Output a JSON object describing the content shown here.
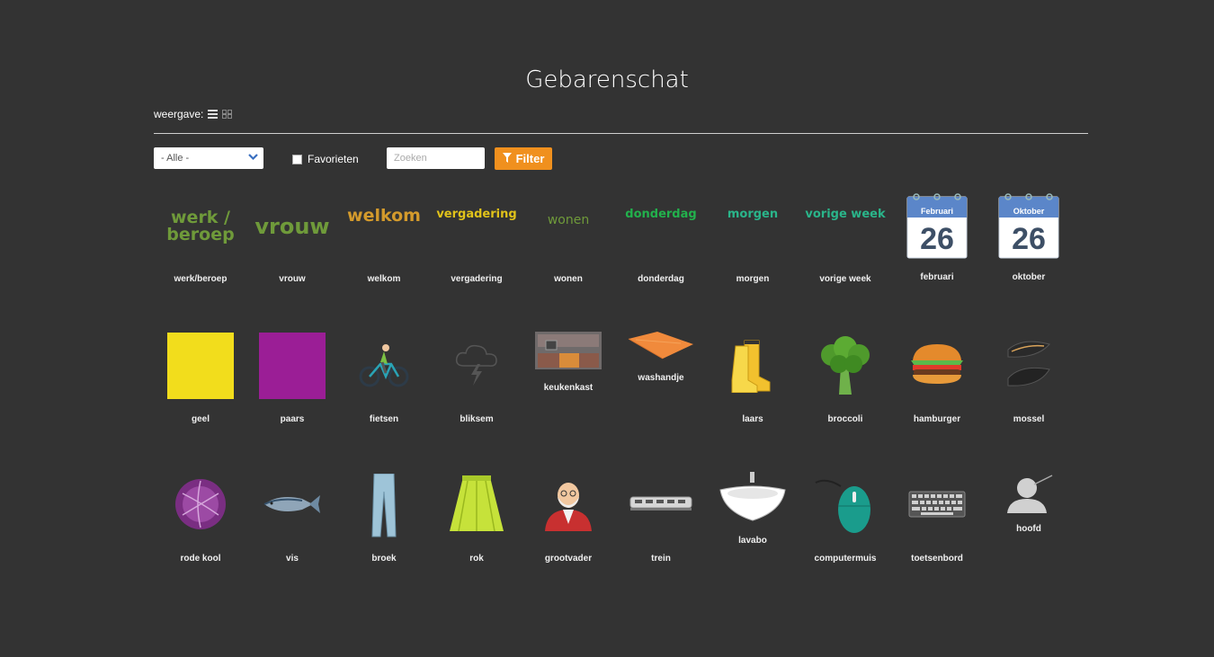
{
  "page": {
    "title": "Gebarenschat"
  },
  "view": {
    "label": "weergave:"
  },
  "filters": {
    "category_selected": "- Alle -",
    "favorites_label": "Favorieten",
    "search_placeholder": "Zoeken",
    "filter_label": "Filter"
  },
  "colors": {
    "background": "#333333",
    "accent": "#f0901e",
    "calendar_blue": "#5b86c9"
  },
  "items": [
    {
      "label": "werk/beroep",
      "image_text": "werk /\nberoep",
      "image_color": "#6f9a3a"
    },
    {
      "label": "vrouw",
      "image_text": "vrouw",
      "image_color": "#6f9a3a"
    },
    {
      "label": "welkom",
      "image_text": "welkom",
      "image_color": "#d39a2c"
    },
    {
      "label": "vergadering",
      "image_text": "vergadering",
      "image_color": "#e0c21a"
    },
    {
      "label": "wonen",
      "image_text": "wonen",
      "image_color": "#6f9a3a"
    },
    {
      "label": "donderdag",
      "image_text": "donderdag",
      "image_color": "#22b14c"
    },
    {
      "label": "morgen",
      "image_text": "morgen",
      "image_color": "#2ab58a"
    },
    {
      "label": "vorige week",
      "image_text": "vorige week",
      "image_color": "#2ab58a"
    },
    {
      "label": "februari",
      "calendar_month": "Februari",
      "calendar_day": "26"
    },
    {
      "label": "oktober",
      "calendar_month": "Oktober",
      "calendar_day": "26"
    },
    {
      "label": "geel",
      "image_color": "#f2dd1c"
    },
    {
      "label": "paars",
      "image_color": "#9b1e96"
    },
    {
      "label": "fietsen",
      "icon": "cyclist-icon"
    },
    {
      "label": "bliksem",
      "icon": "thundercloud-icon"
    },
    {
      "label": "keukenkast",
      "icon": "kitchen-cabinet-icon"
    },
    {
      "label": "washandje",
      "icon": "washcloth-icon"
    },
    {
      "label": "laars",
      "icon": "boots-icon"
    },
    {
      "label": "broccoli",
      "icon": "broccoli-icon"
    },
    {
      "label": "hamburger",
      "icon": "hamburger-icon"
    },
    {
      "label": "mossel",
      "icon": "mussel-icon"
    },
    {
      "label": "rode kool",
      "icon": "red-cabbage-icon"
    },
    {
      "label": "vis",
      "icon": "fish-icon"
    },
    {
      "label": "broek",
      "icon": "trousers-icon"
    },
    {
      "label": "rok",
      "icon": "skirt-icon"
    },
    {
      "label": "grootvader",
      "icon": "grandfather-icon"
    },
    {
      "label": "trein",
      "icon": "train-icon"
    },
    {
      "label": "lavabo",
      "icon": "sink-icon"
    },
    {
      "label": "computermuis",
      "icon": "computer-mouse-icon"
    },
    {
      "label": "toetsenbord",
      "icon": "keyboard-icon"
    },
    {
      "label": "hoofd",
      "icon": "head-icon"
    }
  ]
}
